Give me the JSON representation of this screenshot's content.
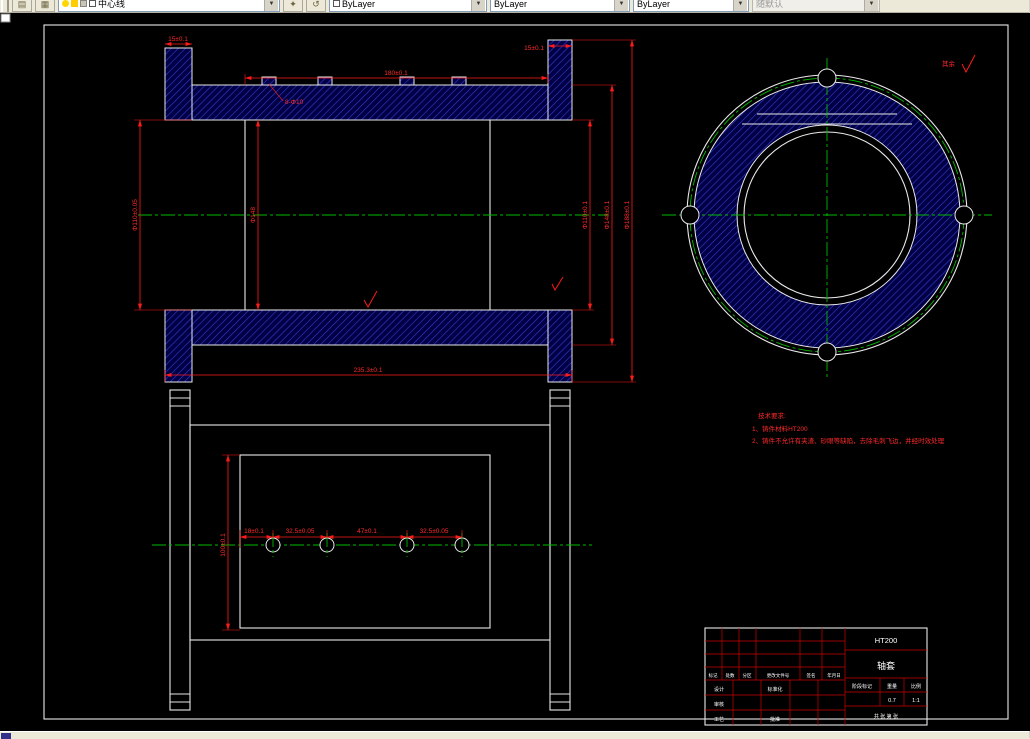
{
  "toolbar": {
    "layer": {
      "value": "中心线"
    },
    "color": {
      "value": "ByLayer"
    },
    "linetype": {
      "value": "ByLayer"
    },
    "lineweight": {
      "value": "ByLayer"
    },
    "plotstyle": {
      "value": "随默认"
    }
  },
  "colors": {
    "canvas_bg": "#000000",
    "object_line": "#e9e9e9",
    "dimension": "#ff1a1a",
    "centerline": "#00bb00",
    "hatch": "#3c3cc8",
    "titleblock_grid": "#cc0000"
  },
  "drawing": {
    "section_view": {
      "dims": {
        "flange_left_thk": "15±0.1",
        "top_width": "180±0.1",
        "flange_right_thk": "15±0.1",
        "holes_note": "8-Φ10",
        "bore": "Φ110±0.05",
        "bore_step": "Φ148",
        "right_d1": "Φ110±0.1",
        "right_d2": "Φ148±0.1",
        "right_d3": "Φ188±0.1",
        "total_len": "235.3±0.1"
      }
    },
    "plan_view": {
      "dims": {
        "h1": "18±0.1",
        "h2": "32.5±0.05",
        "h3": "47±0.1",
        "h4": "32.5±0.05",
        "height": "100±0.1"
      }
    },
    "finish": {
      "rest_label": "其余"
    },
    "notes": {
      "title": "技术要求:",
      "item1": "1、铸件材料HT200",
      "item2": "2、铸件不允许有夹渣、砂眼等缺陷，去除毛刺飞边，并经时效处理"
    },
    "title_block": {
      "material": "HT200",
      "part_name": "轴套",
      "col_mark": "标记",
      "col_count": "处数",
      "col_zone": "分区",
      "col_docno": "更改文件号",
      "col_sign": "签名",
      "col_date": "年月日",
      "design": "设计",
      "standardize": "标准化",
      "check": "审核",
      "process": "工艺",
      "approve": "批准",
      "stage_label": "阶段标记",
      "weight_label": "重量",
      "scale_label": "比例",
      "weight": "0.7",
      "scale": "1:1",
      "sheet": "共 张 第 张"
    }
  }
}
